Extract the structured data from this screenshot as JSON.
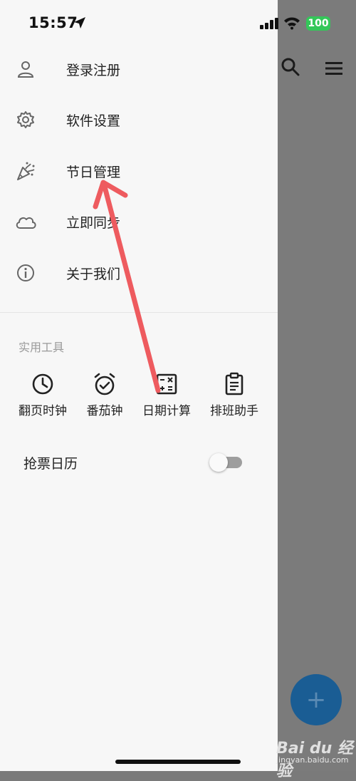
{
  "status": {
    "time": "15:57",
    "battery": "100"
  },
  "drawer": {
    "menu": [
      {
        "label": "登录注册",
        "icon": "user-icon"
      },
      {
        "label": "软件设置",
        "icon": "gear-icon"
      },
      {
        "label": "节日管理",
        "icon": "party-popper-icon"
      },
      {
        "label": "立即同步",
        "icon": "cloud-icon"
      },
      {
        "label": "关于我们",
        "icon": "info-icon"
      }
    ],
    "tools_section_title": "实用工具",
    "tools": [
      {
        "label": "翻页时钟",
        "icon": "clock-icon"
      },
      {
        "label": "番茄钟",
        "icon": "alarm-clock-icon"
      },
      {
        "label": "日期计算",
        "icon": "calculator-icon"
      },
      {
        "label": "排班助手",
        "icon": "clipboard-icon"
      }
    ],
    "toggle": {
      "label": "抢票日历",
      "on": false
    }
  },
  "background": {
    "fab_label": "+",
    "watermark_brand": "Bai du 经验",
    "watermark_site": "jingyan.baidu.com"
  },
  "colors": {
    "drawer_bg": "#f7f7f7",
    "scrim": "#7b7b7b",
    "fab": "#1a5d94",
    "battery": "#34c759",
    "arrow": "#ee5b5f"
  }
}
